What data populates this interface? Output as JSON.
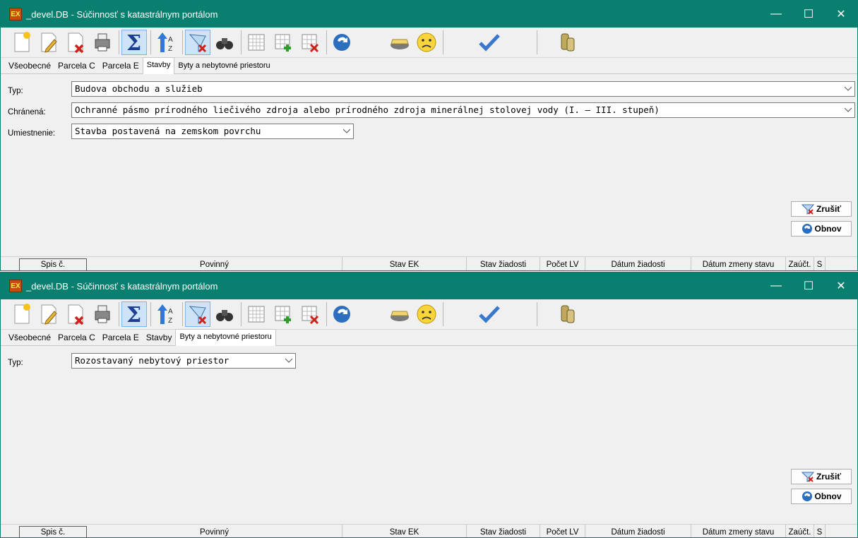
{
  "colors": {
    "titlebar": "#087f6f",
    "body": "#f0f0f0"
  },
  "windows": [
    {
      "title": "_devel.DB - Súčinnosť s katastrálnym portálom",
      "app_icon_text": "EX",
      "controls": {
        "minimize": "—",
        "maximize": "☐",
        "close": "✕"
      },
      "tabs": [
        "Všeobecné",
        "Parcela C",
        "Parcela E",
        "Stavby",
        "Byty a nebytovné priestoru"
      ],
      "selected_tab": "Stavby",
      "fields": {
        "typ_label": "Typ:",
        "typ_value": "Budova obchodu a služieb",
        "chranena_label": "Chránená:",
        "chranena_value": "Ochranné pásmo prírodného liečivého zdroja alebo prírodného zdroja minerálnej stolovej vody (I. – III. stupeň)",
        "umiestnenie_label": "Umiestnenie:",
        "umiestnenie_value": "Stavba postavená na zemskom povrchu"
      },
      "buttons": {
        "zrusit": "Zrušiť",
        "obnov": "Obnov"
      },
      "columns": [
        "Spis č.",
        "Povinný",
        "Stav EK",
        "Stav žiadosti",
        "Počet LV",
        "Dátum žiadosti",
        "Dátum zmeny stavu",
        "Zaúčt.",
        "S"
      ]
    },
    {
      "title": "_devel.DB - Súčinnosť s katastrálnym portálom",
      "app_icon_text": "EX",
      "controls": {
        "minimize": "—",
        "maximize": "☐",
        "close": "✕"
      },
      "tabs": [
        "Všeobecné",
        "Parcela C",
        "Parcela E",
        "Stavby",
        "Byty a nebytovné priestoru"
      ],
      "selected_tab": "Byty a nebytovné priestoru",
      "fields": {
        "typ_label": "Typ:",
        "typ_value": "Rozostavaný nebytový priestor"
      },
      "buttons": {
        "zrusit": "Zrušiť",
        "obnov": "Obnov"
      },
      "columns": [
        "Spis č.",
        "Povinný",
        "Stav EK",
        "Stav žiadosti",
        "Počet LV",
        "Dátum žiadosti",
        "Dátum zmeny stavu",
        "Zaúčt.",
        "S"
      ]
    }
  ],
  "toolbar_icons": [
    "new-record-icon",
    "edit-icon",
    "delete-icon",
    "print-icon",
    "sum-icon",
    "sort-az-icon",
    "clear-filter-icon",
    "find-icon",
    "grid-icon",
    "grid-add-row-icon",
    "grid-delete-row-icon",
    "refresh-icon",
    "soap-icon",
    "sad-face-icon",
    "checkmark-icon",
    "coins-icon"
  ]
}
